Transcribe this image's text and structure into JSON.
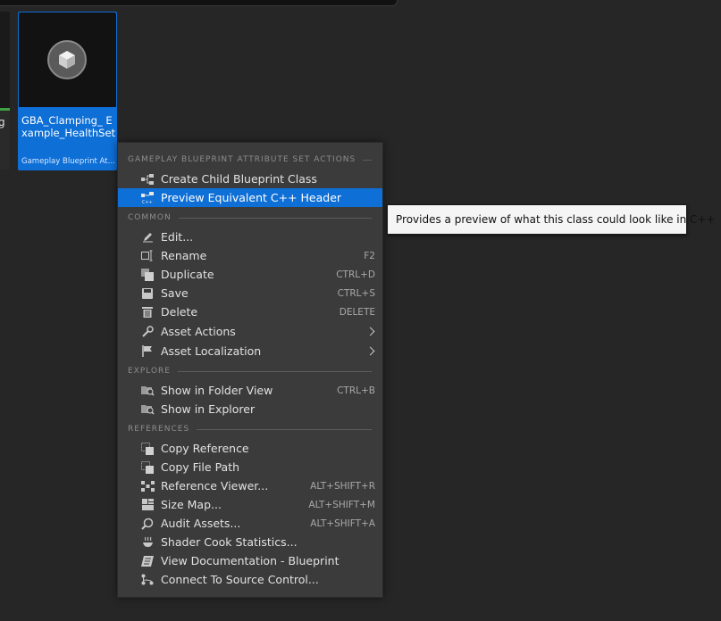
{
  "partial_tile": {
    "name": "g"
  },
  "asset": {
    "name": "GBA_Clamping_ Example_HealthSet",
    "type": "Gameplay Blueprint Attri..."
  },
  "menu": {
    "sections": [
      {
        "header": "GAMEPLAY BLUEPRINT ATTRIBUTE SET ACTIONS",
        "items": [
          {
            "label": "Create Child Blueprint Class",
            "icon": "child-class-icon",
            "shortcut": ""
          },
          {
            "label": "Preview Equivalent C++ Header",
            "icon": "cpp-header-icon",
            "shortcut": "",
            "highlighted": true
          }
        ]
      },
      {
        "header": "COMMON",
        "items": [
          {
            "label": "Edit...",
            "icon": "pencil-icon",
            "shortcut": ""
          },
          {
            "label": "Rename",
            "icon": "rename-icon",
            "shortcut": "F2"
          },
          {
            "label": "Duplicate",
            "icon": "duplicate-icon",
            "shortcut": "CTRL+D"
          },
          {
            "label": "Save",
            "icon": "save-icon",
            "shortcut": "CTRL+S"
          },
          {
            "label": "Delete",
            "icon": "trash-icon",
            "shortcut": "DELETE"
          },
          {
            "label": "Asset Actions",
            "icon": "wrench-icon",
            "shortcut": "",
            "submenu": true
          },
          {
            "label": "Asset Localization",
            "icon": "flag-icon",
            "shortcut": "",
            "submenu": true
          }
        ]
      },
      {
        "header": "EXPLORE",
        "items": [
          {
            "label": "Show in Folder View",
            "icon": "folder-search-icon",
            "shortcut": "CTRL+B"
          },
          {
            "label": "Show in Explorer",
            "icon": "folder-search-icon",
            "shortcut": ""
          }
        ]
      },
      {
        "header": "REFERENCES",
        "items": [
          {
            "label": "Copy Reference",
            "icon": "copy-reference-icon",
            "shortcut": ""
          },
          {
            "label": "Copy File Path",
            "icon": "copy-path-icon",
            "shortcut": ""
          },
          {
            "label": "Reference Viewer...",
            "icon": "reference-graph-icon",
            "shortcut": "ALT+SHIFT+R"
          },
          {
            "label": "Size Map...",
            "icon": "size-map-icon",
            "shortcut": "ALT+SHIFT+M"
          },
          {
            "label": "Audit Assets...",
            "icon": "audit-icon",
            "shortcut": "ALT+SHIFT+A"
          },
          {
            "label": "Shader Cook Statistics...",
            "icon": "shader-stats-icon",
            "shortcut": ""
          },
          {
            "label": "View Documentation - Blueprint",
            "icon": "documentation-icon",
            "shortcut": ""
          },
          {
            "label": "Connect To Source Control...",
            "icon": "source-control-icon",
            "shortcut": ""
          }
        ]
      }
    ]
  },
  "tooltip": {
    "text": "Provides a preview of what this class could look like in C++"
  },
  "colors": {
    "background": "#262626",
    "menu_bg": "#3b3b3b",
    "highlight": "#0e6fd6",
    "tooltip_bg": "#f5f5f5"
  }
}
